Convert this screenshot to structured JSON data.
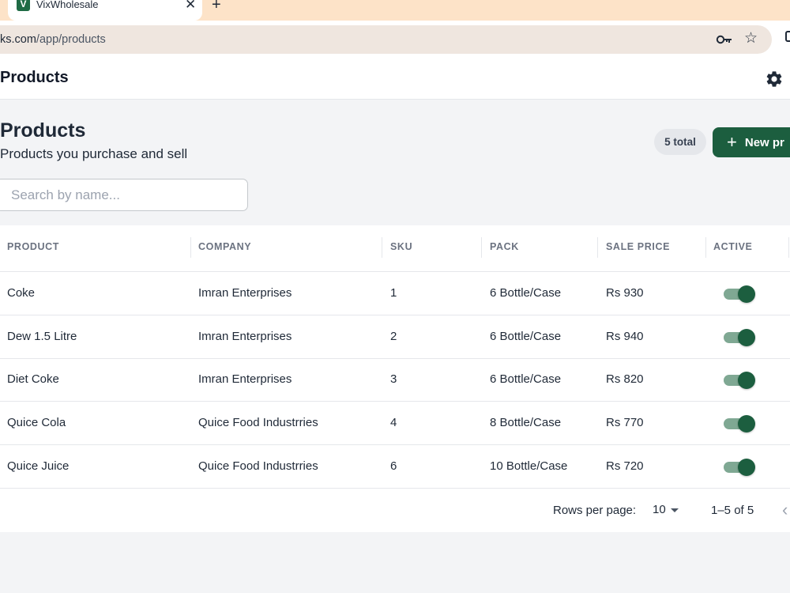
{
  "browser": {
    "tab_title": "VixWholesale",
    "favicon_letter": "V",
    "close_glyph": "✕",
    "new_tab_glyph": "+",
    "minimize_glyph": "–",
    "url_host": "ks.com",
    "url_path": "/app/products",
    "icons": [
      "key-icon",
      "star-icon",
      "extension-icon"
    ]
  },
  "appbar": {
    "title": "Products",
    "settings_icon": "gear-icon"
  },
  "page": {
    "title": "Products",
    "subtitle": "Products you purchase and sell",
    "total_badge": "5 total",
    "new_button_icon": "+",
    "new_button_label": "New pr",
    "accent_color": "#1c5e3f"
  },
  "search": {
    "placeholder": "Search by name...",
    "value": ""
  },
  "table": {
    "columns": [
      "PRODUCT",
      "COMPANY",
      "SKU",
      "PACK",
      "SALE PRICE",
      "ACTIVE"
    ],
    "rows": [
      {
        "product": "Coke",
        "company": "Imran Enterprises",
        "sku": "1",
        "pack": "6 Bottle/Case",
        "price": "Rs 930",
        "active": true
      },
      {
        "product": "Dew 1.5 Litre",
        "company": "Imran Enterprises",
        "sku": "2",
        "pack": "6 Bottle/Case",
        "price": "Rs 940",
        "active": true
      },
      {
        "product": "Diet Coke",
        "company": "Imran Enterprises",
        "sku": "3",
        "pack": "6 Bottle/Case",
        "price": "Rs 820",
        "active": true
      },
      {
        "product": "Quice Cola",
        "company": "Quice Food Industrries",
        "sku": "4",
        "pack": "8 Bottle/Case",
        "price": "Rs 770",
        "active": true
      },
      {
        "product": "Quice Juice",
        "company": "Quice Food Industrries",
        "sku": "6",
        "pack": "10 Bottle/Case",
        "price": "Rs 720",
        "active": true
      }
    ]
  },
  "pagination": {
    "rows_per_page_label": "Rows per page:",
    "rows_per_page_value": "10",
    "range_label": "1–5 of 5",
    "prev_glyph": "‹"
  }
}
